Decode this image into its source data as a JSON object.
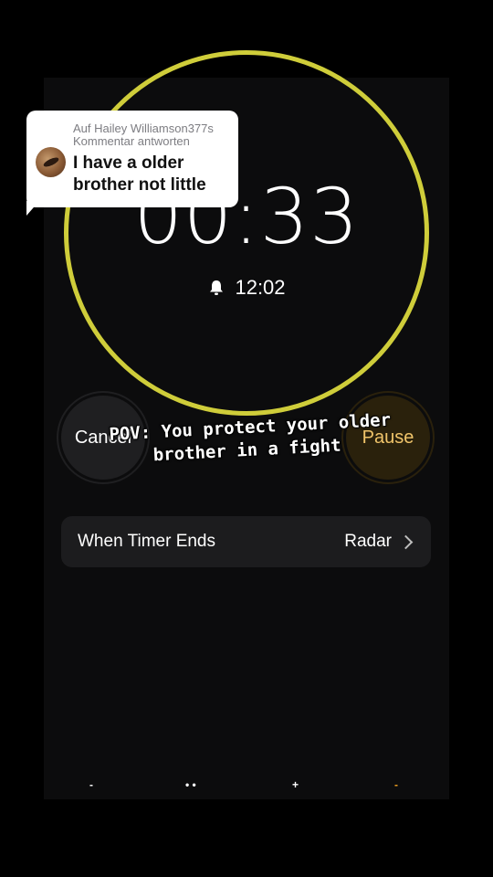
{
  "timer": {
    "remaining": "00:33",
    "alarm_time": "12:02",
    "ring_color": "#cfcd3a"
  },
  "buttons": {
    "cancel_label": "Cancel",
    "pause_label": "Pause",
    "pause_text_color": "#f0c46a"
  },
  "setting": {
    "label": "When Timer Ends",
    "value": "Radar"
  },
  "reply": {
    "header_line1": "Auf Hailey Williamson377s",
    "header_line2": "Kommentar antworten",
    "comment_line1": "I have a older",
    "comment_line2": "brother not little"
  },
  "caption": {
    "line1": "POV: You protect your older",
    "line2": "brother in a fight"
  },
  "tabbar": {
    "marks": [
      "-",
      "• •",
      "+",
      "-"
    ],
    "accent": "#f0a020"
  },
  "icons": {
    "alarm": "bell-icon",
    "chevron": "chevron-right-icon",
    "avatar": "avatar"
  }
}
